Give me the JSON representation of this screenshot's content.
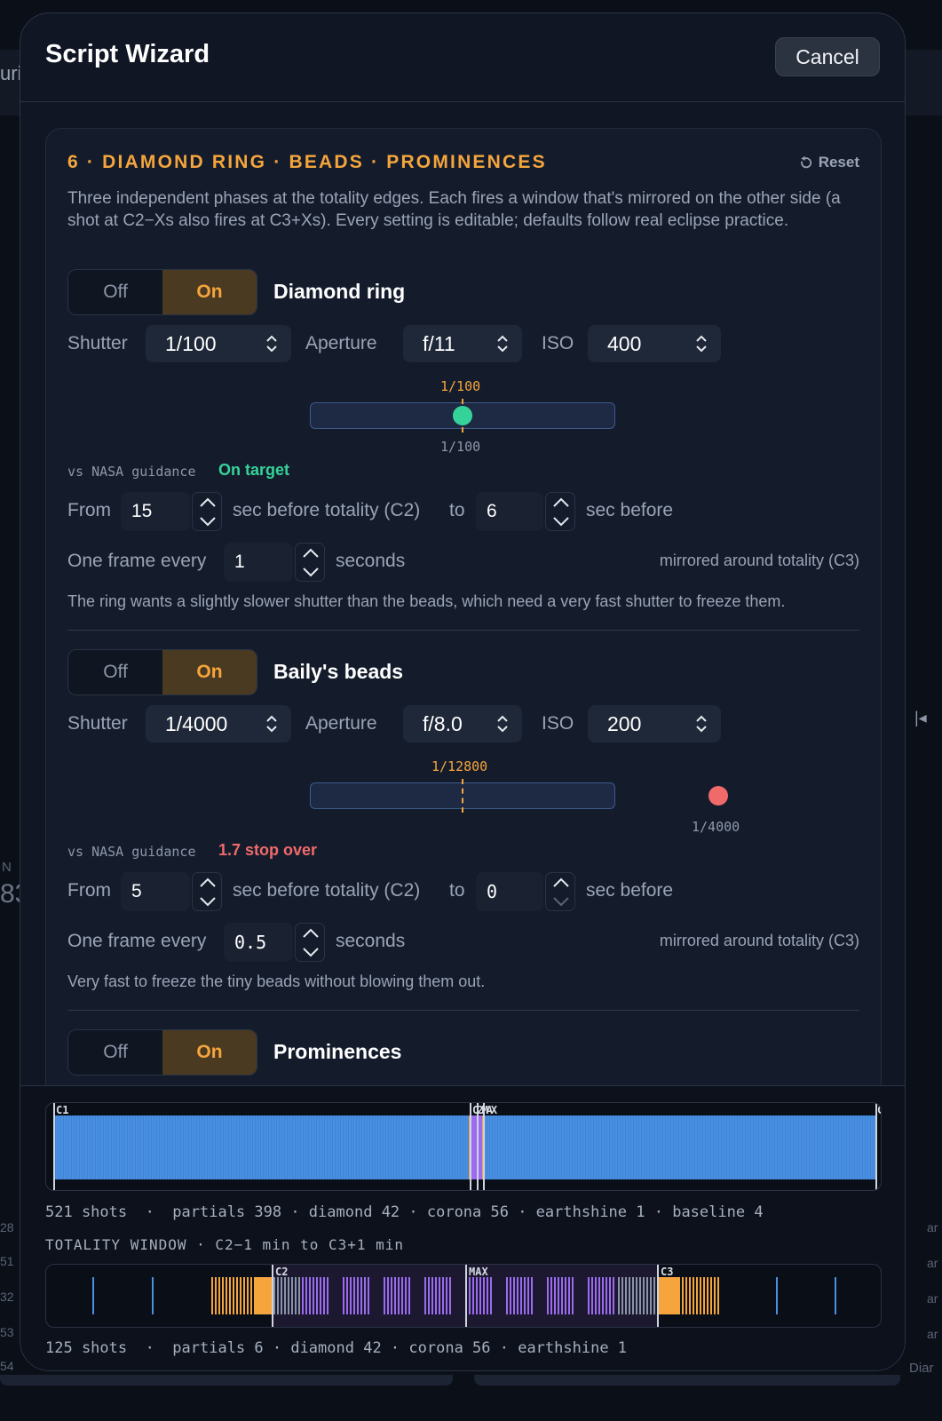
{
  "background": {
    "left_fragment_1": "uri",
    "left_fragment_2": "N",
    "left_fragment_3": "83",
    "left_num_1": "28",
    "left_num_2": "51",
    "left_num_3": "32",
    "left_num_4": "53",
    "left_num_5": "54",
    "right_fragment_1": "ar",
    "right_fragment_2": "ar",
    "right_fragment_3": "ar",
    "right_fragment_4": "ar",
    "right_fragment_5": "Diar",
    "right_icon": "|◂"
  },
  "modal": {
    "title": "Script Wizard",
    "cancel_label": "Cancel"
  },
  "card": {
    "title": "6 · DIAMOND RING · BEADS · PROMINENCES",
    "reset_label": "Reset",
    "intro": "Three independent phases at the totality edges. Each fires a window that's mirrored on the other side (a shot at C2−Xs also fires at C3+Xs). Every setting is editable; defaults follow real eclipse practice."
  },
  "sections": [
    {
      "off_label": "Off",
      "on_label": "On",
      "title": "Diamond ring",
      "shutter_label": "Shutter",
      "shutter": "1/100",
      "aperture_label": "Aperture",
      "aperture": "f/11",
      "iso_label": "ISO",
      "iso": "400",
      "target_label": "1/100",
      "actual_label": "1/100",
      "guidance_label": "vs NASA guidance",
      "guidance_value": "On target",
      "from_label": "From",
      "from_value": "15",
      "mid_label": "sec before totality (C2)",
      "to_label": "to",
      "to_value": "6",
      "after_label": "sec before",
      "every_label": "One frame every",
      "every_value": "1",
      "seconds_label": "seconds",
      "mirror_label": "mirrored around totality (C3)",
      "note": "The ring wants a slightly slower shutter than the beads, which need a very fast shutter to freeze them."
    },
    {
      "off_label": "Off",
      "on_label": "On",
      "title": "Baily's beads",
      "shutter_label": "Shutter",
      "shutter": "1/4000",
      "aperture_label": "Aperture",
      "aperture": "f/8.0",
      "iso_label": "ISO",
      "iso": "200",
      "target_label": "1/12800",
      "actual_label": "1/4000",
      "guidance_label": "vs NASA guidance",
      "guidance_value": "1.7 stop over",
      "from_label": "From",
      "from_value": "5",
      "mid_label": "sec before totality (C2)",
      "to_label": "to",
      "to_value": "0",
      "after_label": "sec before",
      "every_label": "One frame every",
      "every_value": "0.5",
      "seconds_label": "seconds",
      "mirror_label": "mirrored around totality (C3)",
      "note": "Very fast to freeze the tiny beads without blowing them out."
    },
    {
      "off_label": "Off",
      "on_label": "On",
      "title": "Prominences"
    }
  ],
  "timeline_full": {
    "label_c1": "C1",
    "label_mid": "C2MAX",
    "label_end": "C",
    "summary": "521 shots  ·  partials 398 · diamond 42 · corona 56 · earthshine 1 · baseline 4"
  },
  "totality": {
    "title": "TOTALITY WINDOW · C2−1 min to C3+1 min",
    "label_c2": "C2",
    "label_max": "MAX",
    "label_c3": "C3",
    "summary": "125 shots  ·  partials 6 · diamond 42 · corona 56 · earthshine 1"
  },
  "colors": {
    "accent": "#f5a53c",
    "good": "#35d39a",
    "bad": "#f06a6a",
    "partial": "#4a90e2",
    "corona": "#9b6cf0",
    "earthshine": "#8a94a8"
  }
}
